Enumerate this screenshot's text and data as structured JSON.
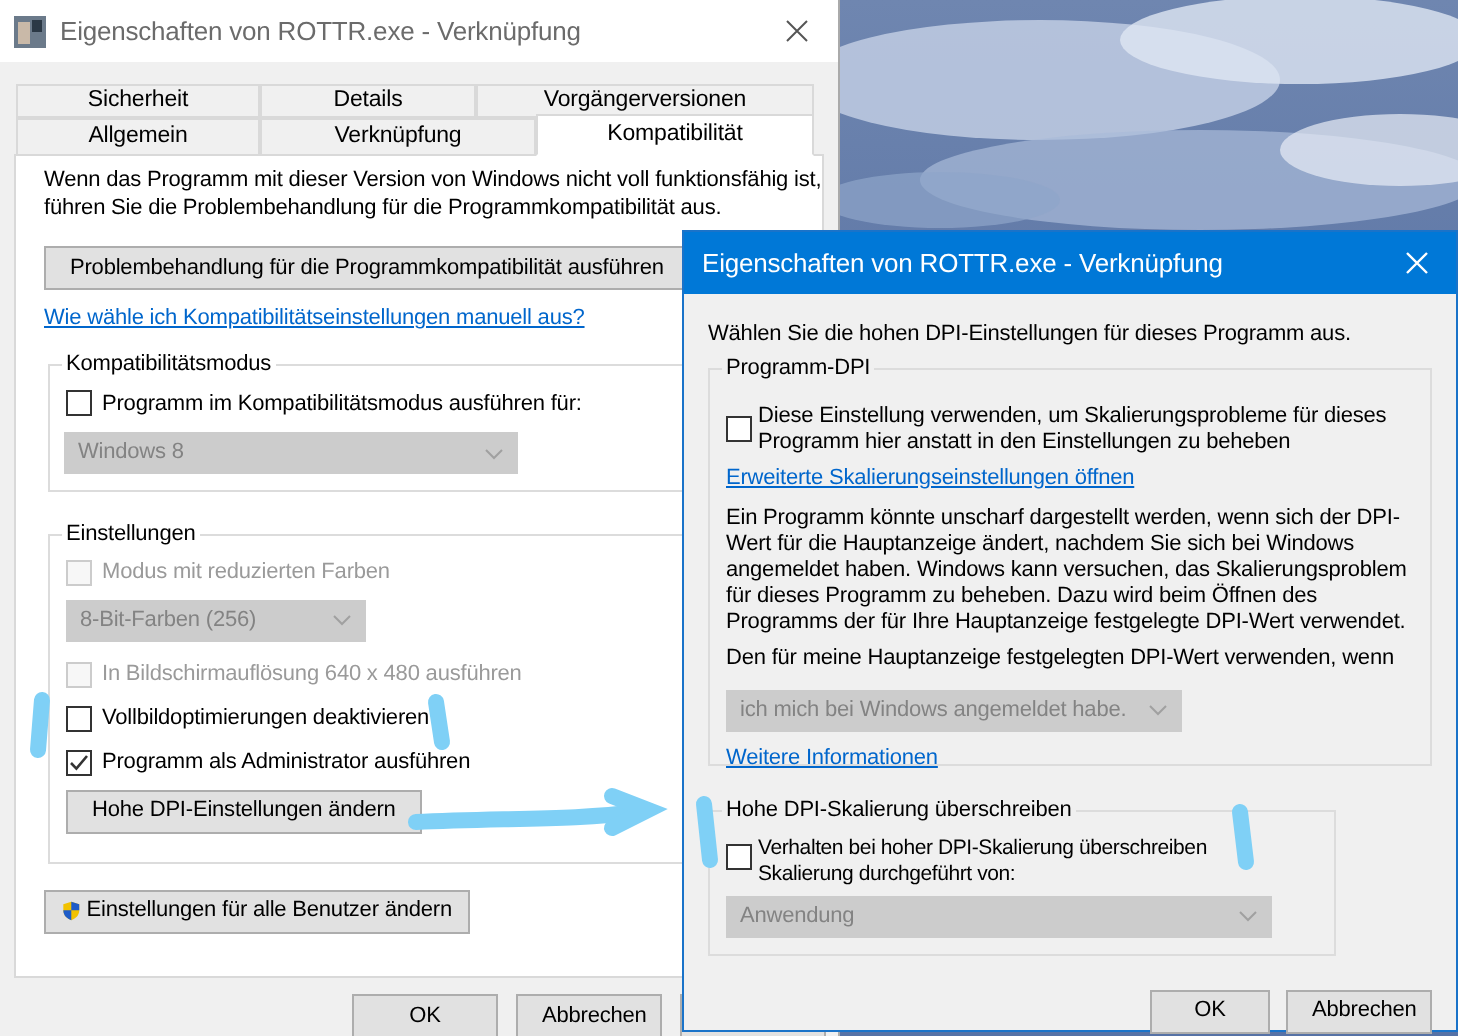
{
  "main_window": {
    "title": "Eigenschaften von ROTTR.exe - Verknüpfung",
    "tab_rows": [
      [
        {
          "label": "Sicherheit",
          "selected": false
        },
        {
          "label": "Details",
          "selected": false
        },
        {
          "label": "Vorgängerversionen",
          "selected": false
        }
      ],
      [
        {
          "label": "Allgemein",
          "selected": false
        },
        {
          "label": "Verknüpfung",
          "selected": false
        },
        {
          "label": "Kompatibilität",
          "selected": true
        }
      ]
    ],
    "intro": "Wenn das Programm mit dieser Version von Windows nicht voll funktionsfähig ist, führen Sie die Problembehandlung für die Programmkompatibilität aus.",
    "troubleshoot_button": "Problembehandlung für die Programmkompatibilität ausführen",
    "help_link": "Wie wähle ich Kompatibilitätseinstellungen manuell aus?",
    "compat_group": {
      "title": "Kompatibilitätsmodus",
      "checkbox": {
        "label": "Programm im Kompatibilitätsmodus ausführen für:",
        "checked": false,
        "disabled": false
      },
      "dropdown": {
        "value": "Windows 8",
        "disabled": true
      }
    },
    "settings_group": {
      "title": "Einstellungen",
      "items": [
        {
          "kind": "checkbox",
          "label": "Modus mit reduzierten Farben",
          "checked": false,
          "disabled": true
        },
        {
          "kind": "dropdown",
          "value": "8-Bit-Farben (256)",
          "disabled": true
        },
        {
          "kind": "checkbox",
          "label": "In Bildschirmauflösung 640 x 480 ausführen",
          "checked": false,
          "disabled": true
        },
        {
          "kind": "checkbox",
          "label": "Vollbildoptimierungen deaktivieren",
          "checked": false,
          "disabled": false
        },
        {
          "kind": "checkbox",
          "label": "Programm als Administrator ausführen",
          "checked": true,
          "disabled": false
        },
        {
          "kind": "button",
          "label": "Hohe DPI-Einstellungen ändern"
        }
      ]
    },
    "all_users_button": "Einstellungen für alle Benutzer ändern",
    "footer_buttons": [
      "OK",
      "Abbrechen"
    ]
  },
  "dialog": {
    "title": "Eigenschaften von ROTTR.exe - Verknüpfung",
    "intro": "Wählen Sie die hohen DPI-Einstellungen für dieses Programm aus.",
    "program_dpi_group": {
      "title": "Programm-DPI",
      "checkbox": {
        "label": "Diese Einstellung verwenden, um Skalierungsprobleme für dieses Programm hier anstatt in den Einstellungen zu beheben",
        "checked": false
      },
      "link": "Erweiterte Skalierungseinstellungen öffnen",
      "description": "Ein Programm könnte unscharf dargestellt werden, wenn sich der DPI-Wert für die Hauptanzeige ändert, nachdem Sie sich bei Windows angemeldet haben. Windows kann versuchen, das Skalierungsproblem für dieses Programm zu beheben. Dazu wird beim Öffnen des Programms der für Ihre Hauptanzeige festgelegte DPI-Wert verwendet.",
      "condition_label": "Den für meine Hauptanzeige festgelegten DPI-Wert verwenden, wenn",
      "dropdown": {
        "value": "ich mich bei Windows angemeldet habe.",
        "disabled": true
      },
      "more_link": "Weitere Informationen"
    },
    "override_group": {
      "title": "Hohe DPI-Skalierung überschreiben",
      "checkbox": {
        "label": "Verhalten bei hoher DPI-Skalierung überschreiben Skalierung durchgeführt von:",
        "checked": false
      },
      "dropdown": {
        "value": "Anwendung",
        "disabled": true
      }
    },
    "buttons": [
      "OK",
      "Abbrechen"
    ]
  }
}
